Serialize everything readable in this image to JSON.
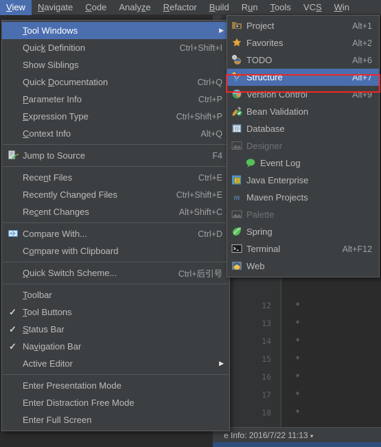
{
  "app": {
    "theme_bg": "#3c3f41",
    "editor_bg": "#2b2b2b",
    "accent": "#4b6eaf",
    "highlight_box_color": "#ef2722"
  },
  "menubar": {
    "items": [
      {
        "label": "View",
        "mnemonic": "V",
        "active": true
      },
      {
        "label": "Navigate",
        "mnemonic": "N",
        "active": false
      },
      {
        "label": "Code",
        "mnemonic": "C",
        "active": false
      },
      {
        "label": "Analyze",
        "mnemonic": "z",
        "active": false
      },
      {
        "label": "Refactor",
        "mnemonic": "R",
        "active": false
      },
      {
        "label": "Build",
        "mnemonic": "B",
        "active": false
      },
      {
        "label": "Run",
        "mnemonic": "u",
        "active": false
      },
      {
        "label": "Tools",
        "mnemonic": "T",
        "active": false
      },
      {
        "label": "VCS",
        "mnemonic": "S",
        "active": false
      },
      {
        "label": "Win",
        "mnemonic": "W",
        "active": false
      }
    ]
  },
  "view_menu": {
    "items": [
      {
        "label": "Tool Windows",
        "accel": "",
        "selected": true,
        "submenu": true,
        "icon": "",
        "check": false
      },
      {
        "label": "Quick Definition",
        "accel": "Ctrl+Shift+I",
        "selected": false,
        "submenu": false,
        "icon": "",
        "check": false
      },
      {
        "label": "Show Siblings",
        "accel": "",
        "selected": false,
        "submenu": false,
        "icon": "",
        "check": false
      },
      {
        "label": "Quick Documentation",
        "accel": "Ctrl+Q",
        "selected": false,
        "submenu": false,
        "icon": "",
        "check": false
      },
      {
        "label": "Parameter Info",
        "accel": "Ctrl+P",
        "selected": false,
        "submenu": false,
        "icon": "",
        "check": false
      },
      {
        "label": "Expression Type",
        "accel": "Ctrl+Shift+P",
        "selected": false,
        "submenu": false,
        "icon": "",
        "check": false
      },
      {
        "label": "Context Info",
        "accel": "Alt+Q",
        "selected": false,
        "submenu": false,
        "icon": "",
        "check": false
      },
      {
        "separator": true
      },
      {
        "label": "Jump to Source",
        "accel": "F4",
        "selected": false,
        "submenu": false,
        "icon": "jump-to-source-icon",
        "check": false
      },
      {
        "separator": true
      },
      {
        "label": "Recent Files",
        "accel": "Ctrl+E",
        "selected": false,
        "submenu": false,
        "icon": "",
        "check": false
      },
      {
        "label": "Recently Changed Files",
        "accel": "Ctrl+Shift+E",
        "selected": false,
        "submenu": false,
        "icon": "",
        "check": false
      },
      {
        "label": "Recent Changes",
        "accel": "Alt+Shift+C",
        "selected": false,
        "submenu": false,
        "icon": "",
        "check": false
      },
      {
        "separator": true
      },
      {
        "label": "Compare With...",
        "accel": "Ctrl+D",
        "selected": false,
        "submenu": false,
        "icon": "compare-icon",
        "check": false
      },
      {
        "label": "Compare with Clipboard",
        "accel": "",
        "selected": false,
        "submenu": false,
        "icon": "",
        "check": false
      },
      {
        "separator": true
      },
      {
        "label": "Quick Switch Scheme...",
        "accel": "Ctrl+后引号",
        "selected": false,
        "submenu": false,
        "icon": "",
        "check": false
      },
      {
        "separator": true
      },
      {
        "label": "Toolbar",
        "accel": "",
        "selected": false,
        "submenu": false,
        "icon": "",
        "check": false
      },
      {
        "label": "Tool Buttons",
        "accel": "",
        "selected": false,
        "submenu": false,
        "icon": "",
        "check": true
      },
      {
        "label": "Status Bar",
        "accel": "",
        "selected": false,
        "submenu": false,
        "icon": "",
        "check": true
      },
      {
        "label": "Navigation Bar",
        "accel": "",
        "selected": false,
        "submenu": false,
        "icon": "",
        "check": true
      },
      {
        "label": "Active Editor",
        "accel": "",
        "selected": false,
        "submenu": true,
        "icon": "",
        "check": false
      },
      {
        "separator": true
      },
      {
        "label": "Enter Presentation Mode",
        "accel": "",
        "selected": false,
        "submenu": false,
        "icon": "",
        "check": false
      },
      {
        "label": "Enter Distraction Free Mode",
        "accel": "",
        "selected": false,
        "submenu": false,
        "icon": "",
        "check": false
      },
      {
        "label": "Enter Full Screen",
        "accel": "",
        "selected": false,
        "submenu": false,
        "icon": "",
        "check": false
      }
    ]
  },
  "tool_windows_submenu": {
    "highlighted_item": "Structure",
    "items": [
      {
        "label": "Project",
        "accel": "Alt+1",
        "icon": "project-folder-icon",
        "selected": false,
        "disabled": false,
        "indent": false
      },
      {
        "label": "Favorites",
        "accel": "Alt+2",
        "icon": "star-icon",
        "selected": false,
        "disabled": false,
        "indent": false
      },
      {
        "label": "TODO",
        "accel": "Alt+6",
        "icon": "todo-icon",
        "selected": false,
        "disabled": false,
        "indent": false
      },
      {
        "label": "Structure",
        "accel": "Alt+7",
        "icon": "structure-icon",
        "selected": true,
        "disabled": false,
        "indent": false
      },
      {
        "label": "Version Control",
        "accel": "Alt+9",
        "icon": "version-control-icon",
        "selected": false,
        "disabled": false,
        "indent": false
      },
      {
        "label": "Bean Validation",
        "accel": "",
        "icon": "bean-validation-icon",
        "selected": false,
        "disabled": false,
        "indent": false
      },
      {
        "label": "Database",
        "accel": "",
        "icon": "database-icon",
        "selected": false,
        "disabled": false,
        "indent": false
      },
      {
        "label": "Designer",
        "accel": "",
        "icon": "designer-icon",
        "selected": false,
        "disabled": true,
        "indent": false
      },
      {
        "label": "Event Log",
        "accel": "",
        "icon": "event-log-icon",
        "selected": false,
        "disabled": false,
        "indent": true
      },
      {
        "label": "Java Enterprise",
        "accel": "",
        "icon": "java-enterprise-icon",
        "selected": false,
        "disabled": false,
        "indent": false
      },
      {
        "label": "Maven Projects",
        "accel": "",
        "icon": "maven-icon",
        "selected": false,
        "disabled": false,
        "indent": false
      },
      {
        "label": "Palette",
        "accel": "",
        "icon": "palette-icon",
        "selected": false,
        "disabled": true,
        "indent": false
      },
      {
        "label": "Spring",
        "accel": "",
        "icon": "spring-leaf-icon",
        "selected": false,
        "disabled": false,
        "indent": false
      },
      {
        "label": "Terminal",
        "accel": "Alt+F12",
        "icon": "terminal-icon",
        "selected": false,
        "disabled": false,
        "indent": false
      },
      {
        "label": "Web",
        "accel": "",
        "icon": "web-icon",
        "selected": false,
        "disabled": false,
        "indent": false
      }
    ]
  },
  "editor": {
    "line_numbers": [
      "12",
      "13",
      "14",
      "15",
      "16",
      "17",
      "18"
    ],
    "line_glyph": "*",
    "status_text": "e Info: 2016/7/22 11:13",
    "status_caret": "▾"
  }
}
